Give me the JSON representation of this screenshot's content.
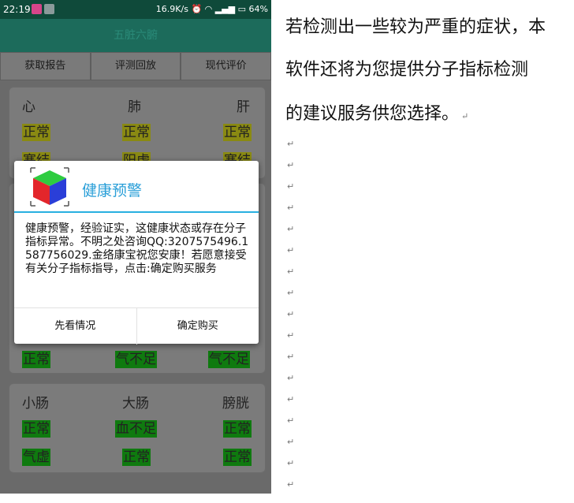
{
  "status_bar": {
    "time": "22:19",
    "speed": "16.9K/s",
    "battery": "64%"
  },
  "app": {
    "title": "五脏六腑"
  },
  "tabs": [
    "获取报告",
    "评测回放",
    "现代评价"
  ],
  "cards": {
    "top": {
      "organs": [
        "心",
        "肺",
        "肝"
      ],
      "row1": [
        "正常",
        "正常",
        "正常"
      ],
      "row2": [
        "寒结",
        "阳虚",
        "寒结"
      ]
    },
    "middle": {
      "row": [
        "正常",
        "气不足",
        "气不足"
      ]
    },
    "bottom": {
      "organs": [
        "小肠",
        "大肠",
        "膀胱"
      ],
      "row1": [
        "正常",
        "血不足",
        "正常"
      ],
      "row2": [
        "气虚",
        "正常",
        "正常"
      ]
    }
  },
  "dialog": {
    "title": "健康预警",
    "message": "健康预警，经验证实，这健康状态或存在分子指标异常。不明之处咨询QQ:3207575496.1587756029.金络康宝祝您安康！若愿意接受有关分子指标指导，点击:确定购买服务",
    "cancel_label": "先看情况",
    "confirm_label": "确定购买"
  },
  "document": {
    "lines": [
      "若检测出一些较为严重的症状，本",
      "软件还将为您提供分子指标检测",
      "的建议服务供您选择。"
    ],
    "para_mark": "↵"
  }
}
